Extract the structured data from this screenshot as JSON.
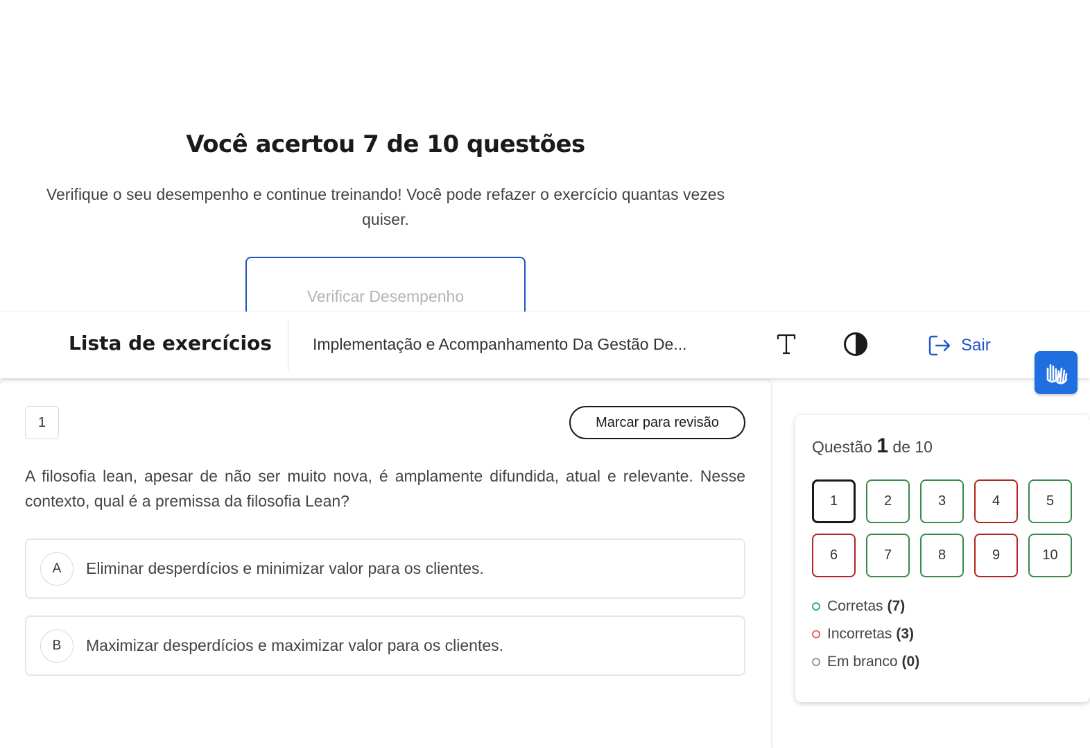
{
  "result": {
    "title": "Você acertou 7 de 10 questões",
    "subtitle": "Verifique o seu desempenho e continue treinando! Você pode refazer o exercício quantas vezes quiser.",
    "verify_button": "Verificar Desempenho"
  },
  "header": {
    "title": "Lista de exercícios",
    "course": "Implementação e Acompanhamento Da Gestão De...",
    "font_icon": "text-size-icon",
    "contrast_icon": "contrast-icon",
    "exit_label": "Sair",
    "exit_icon": "logout-icon",
    "accent_color": "#1f55c8"
  },
  "accessibility": {
    "icon": "sign-language-hands-icon",
    "color": "#1f6fe0"
  },
  "question": {
    "number": "1",
    "review_button": "Marcar para revisão",
    "text": "A filosofia lean, apesar de não ser muito nova, é amplamente difundida, atual e relevante. Nesse contexto, qual é a premissa da filosofia Lean?",
    "options": [
      {
        "letter": "A",
        "text": "Eliminar desperdícios e minimizar valor para os clientes."
      },
      {
        "letter": "B",
        "text": "Maximizar desperdícios e maximizar valor para os clientes."
      }
    ]
  },
  "navigator": {
    "label_prefix": "Questão",
    "current": "1",
    "label_suffix": "de 10",
    "cells": [
      {
        "label": "1",
        "status": "current"
      },
      {
        "label": "2",
        "status": "correct"
      },
      {
        "label": "3",
        "status": "correct"
      },
      {
        "label": "4",
        "status": "wrong"
      },
      {
        "label": "5",
        "status": "correct"
      },
      {
        "label": "6",
        "status": "wrong"
      },
      {
        "label": "7",
        "status": "correct"
      },
      {
        "label": "8",
        "status": "correct"
      },
      {
        "label": "9",
        "status": "wrong"
      },
      {
        "label": "10",
        "status": "correct"
      }
    ],
    "legend": [
      {
        "label": "Corretas",
        "count": "(7)",
        "color": "#3cb371"
      },
      {
        "label": "Incorretas",
        "count": "(3)",
        "color": "#e0685a"
      },
      {
        "label": "Em branco",
        "count": "(0)",
        "color": "#999999"
      }
    ]
  }
}
